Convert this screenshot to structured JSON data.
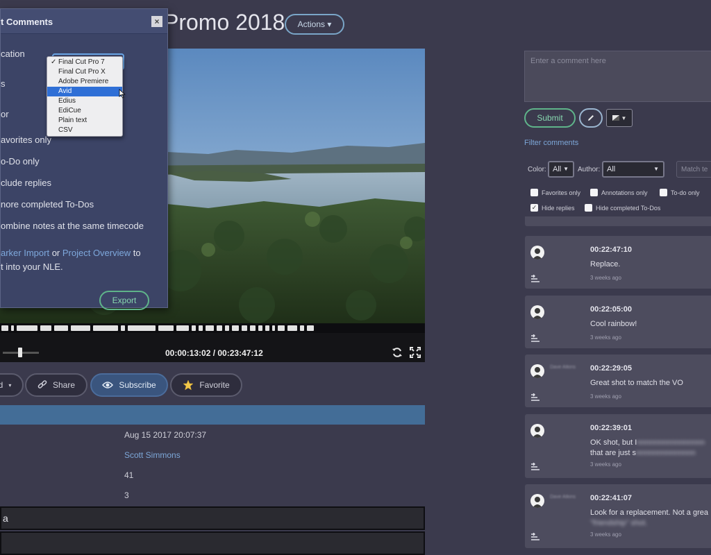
{
  "header": {
    "title": "Promo 2018",
    "actions_label": "Actions ▾"
  },
  "player": {
    "timecode": "00:00:13:02 / 00:23:47:12",
    "volume": 0.5
  },
  "video_buttons": {
    "download": "d",
    "share": "Share",
    "subscribe": "Subscribe",
    "favorite": "Favorite"
  },
  "details": {
    "date": "Aug 15 2017 20:07:37",
    "owner": "Scott Simmons",
    "count_1": "41",
    "count_2": "3",
    "field_1": "a",
    "field_2": ""
  },
  "export_dialog": {
    "title": "t Comments",
    "close": "×",
    "location_label": "cation",
    "label_2": "s",
    "label_3": "or",
    "options": [
      "avorites only",
      "o-Do only",
      "clude replies",
      "nore completed To-Dos",
      "ombine notes at the same timecode"
    ],
    "help_link_1": "arker Import",
    "help_or": " or ",
    "help_link_2": "Project Overview",
    "help_to": " to",
    "help_line2": "t into your NLE.",
    "export_label": "Export",
    "dropdown": {
      "check": "✓",
      "items": [
        "Final Cut Pro 7",
        "Final Cut Pro X",
        "Adobe Premiere",
        "Avid",
        "Edius",
        "EdiCue",
        "Plain text",
        "CSV"
      ],
      "selected": "Avid"
    }
  },
  "comments_panel": {
    "input_placeholder": "Enter a comment here",
    "submit": "Submit",
    "filter_link": "Filter comments",
    "color_label": "Color:",
    "color_value": "All",
    "author_label": "Author:",
    "author_value": "All",
    "match_placeholder": "Match te",
    "checkboxes": [
      {
        "label": "Favorites only",
        "checked": false
      },
      {
        "label": "Annotations only",
        "checked": false
      },
      {
        "label": "To-do only",
        "checked": false
      },
      {
        "label": "Hide replies",
        "checked": true
      },
      {
        "label": "Hide completed To-Dos",
        "checked": false
      }
    ],
    "comments": [
      {
        "author": "",
        "timecode": "00:22:47:10",
        "text": "Replace.",
        "ago": "3 weeks ago"
      },
      {
        "author": "",
        "timecode": "00:22:05:00",
        "text": "Cool rainbow!",
        "ago": "3 weeks ago"
      },
      {
        "author": "Dave Atkins",
        "timecode": "00:22:29:05",
        "text": "Great shot to match the VO",
        "ago": "3 weeks ago"
      },
      {
        "author": "",
        "timecode": "00:22:39:01",
        "text": "OK shot, but I",
        "text_2": "that are just s",
        "ago": "3 weeks ago"
      },
      {
        "author": "Dave Atkins",
        "timecode": "00:22:41:07",
        "text": "Look for a replacement. Not a grea",
        "text_2": "\"friendship\" shot.",
        "ago": "3 weeks ago"
      }
    ]
  },
  "colors": {
    "background": "#3b3a4d",
    "accent_green": "#5fb48a",
    "accent_blue": "#436d97",
    "link": "#7da7d8"
  }
}
